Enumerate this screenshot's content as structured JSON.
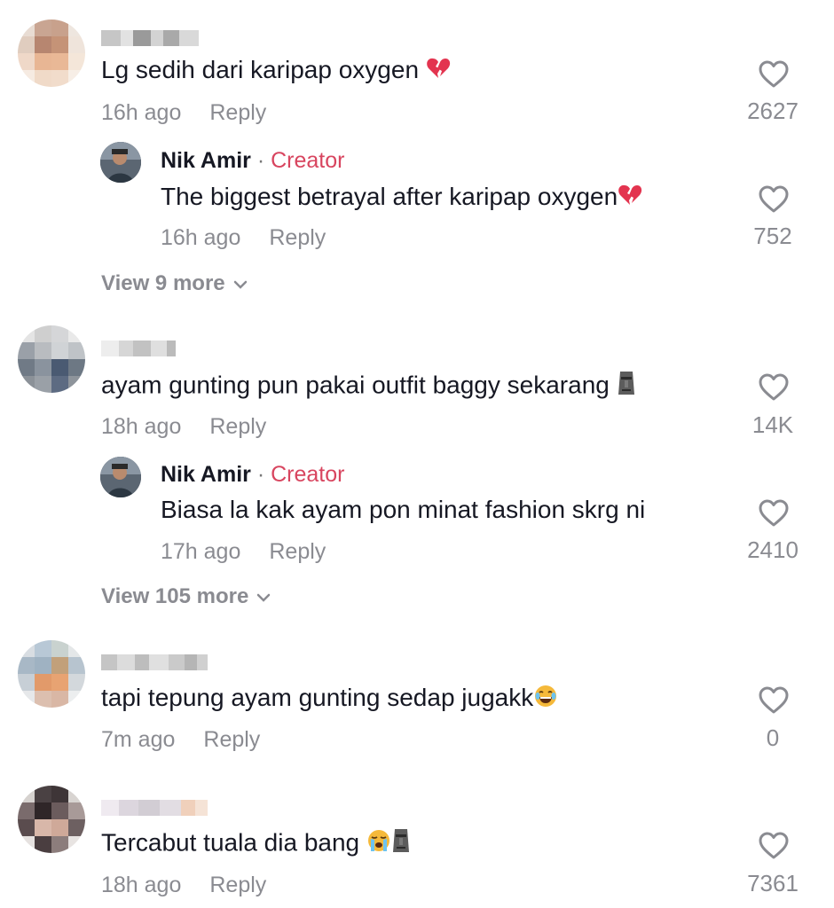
{
  "comments": [
    {
      "text": "Lg sedih dari karipap oxygen",
      "emoji": "broken-heart-icon",
      "time": "16h ago",
      "reply_label": "Reply",
      "likes": "2627",
      "creator_reply": {
        "name": "Nik Amir",
        "separator": "·",
        "tag": "Creator",
        "text": "The biggest betrayal after karipap oxygen",
        "emoji": "broken-heart-icon",
        "time": "16h ago",
        "reply_label": "Reply",
        "likes": "752"
      },
      "view_more": "View 9 more"
    },
    {
      "text": "ayam gunting pun pakai outfit baggy sekarang",
      "emoji": "moai-icon",
      "time": "18h ago",
      "reply_label": "Reply",
      "likes": "14K",
      "creator_reply": {
        "name": "Nik Amir",
        "separator": "·",
        "tag": "Creator",
        "text": "Biasa la kak ayam pon minat fashion skrg ni",
        "time": "17h ago",
        "reply_label": "Reply",
        "likes": "2410"
      },
      "view_more": "View 105 more"
    },
    {
      "text": "tapi tepung ayam gunting sedap jugakk",
      "emoji": "laughing-icon",
      "time": "7m ago",
      "reply_label": "Reply",
      "likes": "0"
    },
    {
      "text": "Tercabut tuala dia bang",
      "emoji": "crying-moai-icons",
      "time": "18h ago",
      "reply_label": "Reply",
      "likes": "7361"
    }
  ],
  "colors": {
    "text": "#161823",
    "muted": "#8a8b91",
    "creator_tag": "#d8455f"
  }
}
